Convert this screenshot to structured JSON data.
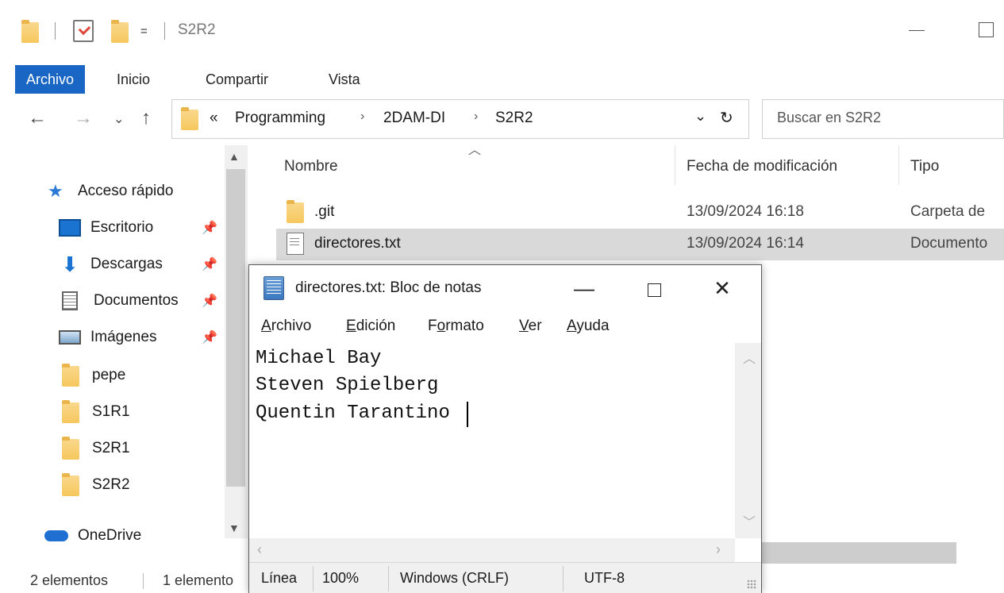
{
  "window": {
    "title": "S2R2",
    "quick_access_dropdown": "="
  },
  "ribbon": {
    "tabs": [
      "Archivo",
      "Inicio",
      "Compartir",
      "Vista"
    ]
  },
  "address": {
    "prefix": "«",
    "crumbs": [
      "Programming",
      "2DAM-DI",
      "S2R2"
    ],
    "separator": "›",
    "search_placeholder": "Buscar en S2R2"
  },
  "sidebar": {
    "items": [
      {
        "label": "Acceso rápido",
        "icon": "star-icon"
      },
      {
        "label": "Escritorio",
        "icon": "desktop-icon",
        "pinned": true
      },
      {
        "label": "Descargas",
        "icon": "download-icon",
        "pinned": true
      },
      {
        "label": "Documentos",
        "icon": "documents-icon",
        "pinned": true
      },
      {
        "label": "Imágenes",
        "icon": "pictures-icon",
        "pinned": true
      },
      {
        "label": "pepe",
        "icon": "folder-icon"
      },
      {
        "label": "S1R1",
        "icon": "folder-icon"
      },
      {
        "label": "S2R1",
        "icon": "folder-icon"
      },
      {
        "label": "S2R2",
        "icon": "folder-icon"
      },
      {
        "label": "OneDrive",
        "icon": "cloud-icon"
      }
    ]
  },
  "filelist": {
    "columns": [
      "Nombre",
      "Fecha de modificación",
      "Tipo"
    ],
    "rows": [
      {
        "name": ".git",
        "date": "13/09/2024 16:18",
        "type": "Carpeta de",
        "icon": "folder-icon"
      },
      {
        "name": "directores.txt",
        "date": "13/09/2024 16:14",
        "type": "Documento",
        "icon": "text-file-icon",
        "selected": true
      }
    ]
  },
  "status": {
    "count": "2 elementos",
    "selected": "1 elemento"
  },
  "notepad": {
    "title": "directores.txt: Bloc de notas",
    "menu": [
      {
        "label": "Archivo",
        "mnemonic": "A",
        "rest": "rchivo"
      },
      {
        "label": "Edición",
        "mnemonic": "E",
        "rest": "dición"
      },
      {
        "label": "Formato",
        "pre": "F",
        "mnemonic": "o",
        "rest": "rmato"
      },
      {
        "label": "Ver",
        "mnemonic": "V",
        "rest": "er"
      },
      {
        "label": "Ayuda",
        "mnemonic": "A",
        "rest": "yuda"
      }
    ],
    "lines": [
      "Michael Bay",
      "Steven Spielberg",
      "Quentin Tarantino"
    ],
    "status": {
      "position": "Línea",
      "zoom": "100%",
      "line_ending": "Windows (CRLF)",
      "encoding": "UTF-8"
    }
  }
}
